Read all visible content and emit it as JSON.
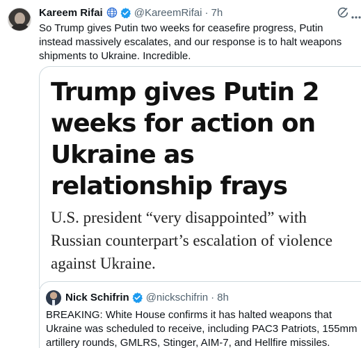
{
  "tweet": {
    "author_name": "Kareem Rifai",
    "handle": "@KareemRifai",
    "separator": "·",
    "time": "7h",
    "text": "So Trump gives Putin two weeks for ceasefire progress, Putin instead massively escalates, and our response is to halt weapons shipments to Ukraine. Incredible.",
    "icons": {
      "avatar": "profile-photo",
      "affiliation": "globe-icon",
      "verified": "verified-badge-icon",
      "grok": "grok-icon"
    },
    "colors": {
      "verified": "#1d9bf0",
      "secondary_text": "#536471",
      "border": "#cfd9de"
    }
  },
  "article_card": {
    "headline": "Trump gives Putin 2 weeks for action on Ukraine as relationship frays",
    "subheadline": "U.S. president “very disappointed” with Russian counterpart’s escalation of violence against Ukraine."
  },
  "quoted_tweet": {
    "author_name": "Nick Schifrin",
    "handle": "@nickschifrin",
    "separator": "·",
    "time": "8h",
    "text": "BREAKING: White House confirms it has halted weapons that Ukraine was scheduled to receive, including PAC3 Patriots, 155mm artillery rounds, GMLRS, Stinger, AIM-7, and Hellfire missiles."
  }
}
